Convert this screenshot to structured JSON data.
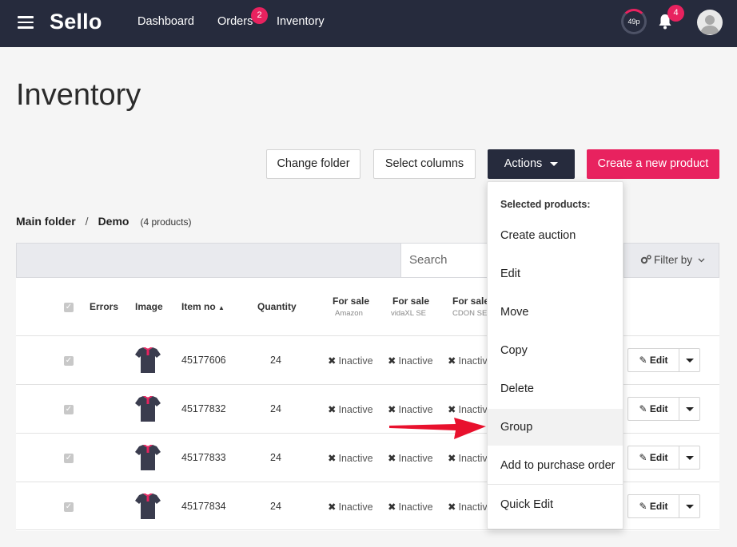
{
  "nav": {
    "logo": "Sello",
    "links": [
      {
        "label": "Dashboard"
      },
      {
        "label": "Orders",
        "badge": "2"
      },
      {
        "label": "Inventory"
      }
    ],
    "progress": "49p",
    "notifications_badge": "4"
  },
  "page": {
    "title": "Inventory"
  },
  "toolbar": {
    "change_folder": "Change folder",
    "select_columns": "Select columns",
    "actions": "Actions",
    "create_product": "Create a new product"
  },
  "breadcrumb": {
    "root": "Main folder",
    "separator": "/",
    "current": "Demo",
    "count": "(4 products)"
  },
  "filter": {
    "search_placeholder": "Search",
    "filter_by": "Filter by"
  },
  "table": {
    "headers": {
      "errors": "Errors",
      "image": "Image",
      "item_no": "Item no",
      "quantity": "Quantity",
      "for_sale": "For sale",
      "amazon": "Amazon",
      "vidaxl": "vidaXL SE",
      "cdon": "CDON SE"
    },
    "rows": [
      {
        "item_no": "45177606",
        "quantity": "24",
        "amazon": "Inactive",
        "vidaxl": "Inactive",
        "cdon": "Inactive",
        "edit": "Edit"
      },
      {
        "item_no": "45177832",
        "quantity": "24",
        "amazon": "Inactive",
        "vidaxl": "Inactive",
        "cdon": "Inactive",
        "edit": "Edit"
      },
      {
        "item_no": "45177833",
        "quantity": "24",
        "amazon": "Inactive",
        "vidaxl": "Inactive",
        "cdon": "Inactive",
        "edit": "Edit"
      },
      {
        "item_no": "45177834",
        "quantity": "24",
        "amazon": "Inactive",
        "vidaxl": "Inactive",
        "cdon": "Inactive",
        "edit": "Edit"
      }
    ]
  },
  "actions_menu": {
    "header": "Selected products:",
    "items": [
      {
        "label": "Create auction"
      },
      {
        "label": "Edit"
      },
      {
        "label": "Move"
      },
      {
        "label": "Copy"
      },
      {
        "label": "Delete"
      },
      {
        "label": "Group"
      },
      {
        "label": "Add to purchase order"
      },
      {
        "label": "Quick Edit"
      }
    ]
  },
  "colors": {
    "nav_bg": "#262b3d",
    "accent": "#e8225f",
    "arrow": "#e8112d"
  }
}
